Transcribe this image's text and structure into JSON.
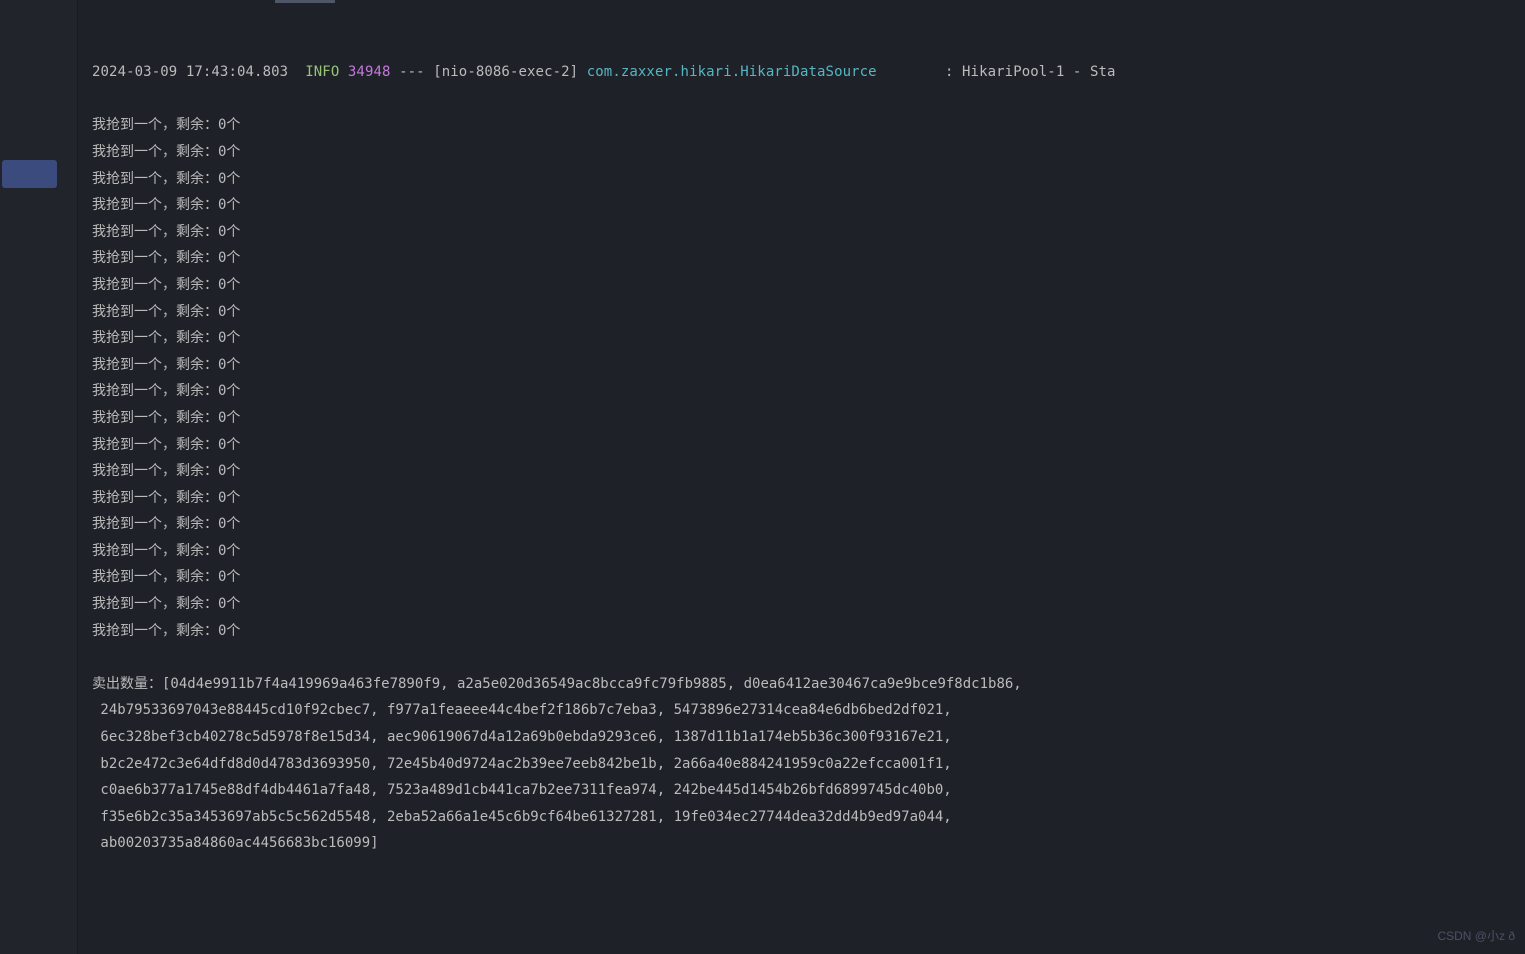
{
  "logHeader": {
    "timestamp": "2024-03-09 17:43:04.803",
    "level": "INFO",
    "pid": "34948",
    "separator": "---",
    "thread": "[nio-8086-exec-2]",
    "logger": "com.zaxxer.hikari.HikariDataSource",
    "colon": ":",
    "message": "HikariPool-1 - Sta"
  },
  "outputLines": [
    "我抢到一个，剩余：0个",
    "我抢到一个，剩余：0个",
    "我抢到一个，剩余：0个",
    "我抢到一个，剩余：0个",
    "我抢到一个，剩余：0个",
    "我抢到一个，剩余：0个",
    "我抢到一个，剩余：0个",
    "我抢到一个，剩余：0个",
    "我抢到一个，剩余：0个",
    "我抢到一个，剩余：0个",
    "我抢到一个，剩余：0个",
    "我抢到一个，剩余：0个",
    "我抢到一个，剩余：0个",
    "我抢到一个，剩余：0个",
    "我抢到一个，剩余：0个",
    "我抢到一个，剩余：0个",
    "我抢到一个，剩余：0个",
    "我抢到一个，剩余：0个",
    "我抢到一个，剩余：0个",
    "我抢到一个，剩余：0个"
  ],
  "soldLabel": "卖出数量：",
  "soldHashes": [
    "04d4e9911b7f4a419969a463fe7890f9",
    "a2a5e020d36549ac8bcca9fc79fb9885",
    "d0ea6412ae30467ca9e9bce9f8dc1b86",
    "24b79533697043e88445cd10f92cbec7",
    "f977a1feaeee44c4bef2f186b7c7eba3",
    "5473896e27314cea84e6db6bed2df021",
    "6ec328bef3cb40278c5d5978f8e15d34",
    "aec90619067d4a12a69b0ebda9293ce6",
    "1387d11b1a174eb5b36c300f93167e21",
    "b2c2e472c3e64dfd8d0d4783d3693950",
    "72e45b40d9724ac2b39ee7eeb842be1b",
    "2a66a40e884241959c0a22efcca001f1",
    "c0ae6b377a1745e88df4db4461a7fa48",
    "7523a489d1cb441ca7b2ee7311fea974",
    "242be445d1454b26bfd6899745dc40b0",
    "f35e6b2c35a3453697ab5c5c562d5548",
    "2eba52a66a1e45c6b9cf64be61327281",
    "19fe034ec27744dea32dd4b9ed97a044",
    "ab00203735a84860ac4456683bc16099"
  ],
  "watermark": "CSDN @小z ð"
}
